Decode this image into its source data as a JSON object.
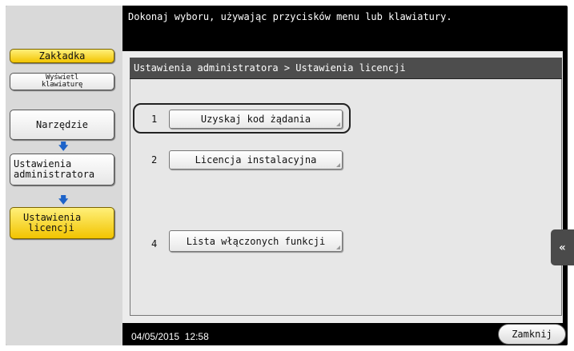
{
  "instruction": "Dokonaj wyboru, używając przycisków menu lub klawiatury.",
  "sidebar": {
    "tab_label": "Zakładka",
    "keyboard_label": "Wyświetl klawiaturę",
    "tool_label": "Narzędzie",
    "admin_label": "Ustawienia administratora",
    "license_label": "Ustawienia licencji"
  },
  "breadcrumb": "Ustawienia administratora  > Ustawienia licencji",
  "functions": [
    {
      "number": "1",
      "label": "Uzyskaj kod żądania"
    },
    {
      "number": "2",
      "label": "Licencja instalacyjna"
    },
    {
      "number": "4",
      "label": "Lista włączonych funkcji"
    }
  ],
  "side_tab_icon": "double-left-chevron-icon",
  "side_tab_glyph": "«",
  "footer": {
    "datetime": "04/05/2015  12:58",
    "close_label": "Zamknij"
  },
  "colors": {
    "highlight_yellow": "#f2c400",
    "arrow_blue": "#1d63c9",
    "header_black": "#000000"
  }
}
